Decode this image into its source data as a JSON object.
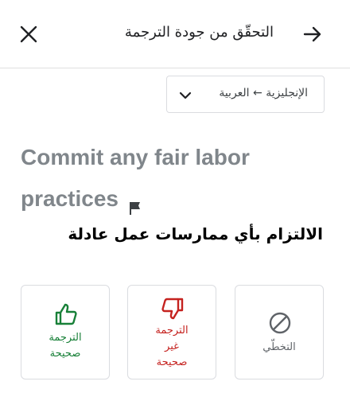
{
  "header": {
    "title": "التحقّق من جودة الترجمة",
    "close_icon": "close-icon",
    "back_icon": "arrow-forward-icon"
  },
  "language_selector": {
    "label": "الإنجليزية ← العربية",
    "icon": "chevron-down-icon"
  },
  "source_text": "Commit any fair labor practices",
  "flag_icon": "flag-icon",
  "translation_text": "الالتزام بأي ممارسات عمل عادلة",
  "actions": {
    "correct": {
      "line1": "الترجمة",
      "line2": "صحيحة",
      "icon": "thumbs-up-icon",
      "color": "#188038"
    },
    "incorrect": {
      "line1": "الترجمة",
      "line2": "غير",
      "line3": "صحيحة",
      "icon": "thumbs-down-icon",
      "color": "#c5221f"
    },
    "skip": {
      "label": "التخطّي",
      "icon": "skip-icon",
      "color": "#5f6368"
    }
  }
}
